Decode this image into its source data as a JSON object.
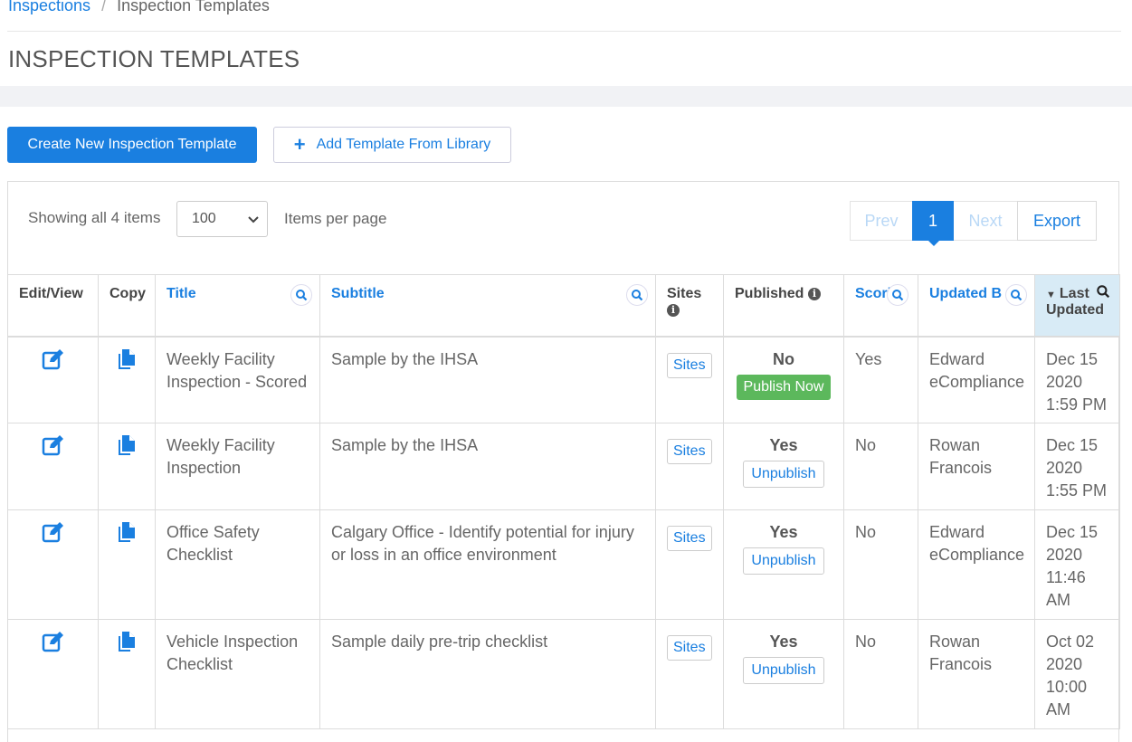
{
  "breadcrumb": {
    "parent": "Inspections",
    "separator": "/",
    "current": "Inspection Templates"
  },
  "page_title": "INSPECTION TEMPLATES",
  "actions": {
    "create": "Create New Inspection Template",
    "add_from_library": "Add Template From Library"
  },
  "list_controls": {
    "showing": "Showing all 4 items",
    "per_page_value": "100",
    "per_page_label": "Items per page",
    "prev": "Prev",
    "current_page": "1",
    "next": "Next",
    "export": "Export"
  },
  "columns": {
    "edit_view": "Edit/View",
    "copy": "Copy",
    "title": "Title",
    "subtitle": "Subtitle",
    "sites": "Sites",
    "published": "Published",
    "scoring": "Scori",
    "updated_by": "Updated B",
    "last_updated_1": "Last",
    "last_updated_2": "Updated"
  },
  "rows": [
    {
      "title": "Weekly Facility Inspection - Scored",
      "subtitle": "Sample by the IHSA",
      "sites": "Sites",
      "published": "No",
      "pub_action": "Publish Now",
      "scored": "Yes",
      "updated_by": "Edward eCompliance",
      "last_updated": "Dec 15 2020 1:59 PM"
    },
    {
      "title": "Weekly Facility Inspection",
      "subtitle": "Sample by the IHSA",
      "sites": "Sites",
      "published": "Yes",
      "pub_action": "Unpublish",
      "scored": "No",
      "updated_by": "Rowan Francois",
      "last_updated": "Dec 15 2020 1:55 PM"
    },
    {
      "title": "Office Safety Checklist",
      "subtitle": "Calgary Office - Identify potential for injury or loss in an office environment",
      "sites": "Sites",
      "published": "Yes",
      "pub_action": "Unpublish",
      "scored": "No",
      "updated_by": "Edward eCompliance",
      "last_updated": "Dec 15 2020 11:46 AM"
    },
    {
      "title": "Vehicle Inspection Checklist",
      "subtitle": "Sample daily pre-trip checklist",
      "sites": "Sites",
      "published": "Yes",
      "pub_action": "Unpublish",
      "scored": "No",
      "updated_by": "Rowan Francois",
      "last_updated": "Oct 02 2020 10:00 AM"
    }
  ],
  "colors": {
    "primary": "#1a7fe0",
    "success": "#5cb85c",
    "sorted_header": "#d8ebf6"
  }
}
